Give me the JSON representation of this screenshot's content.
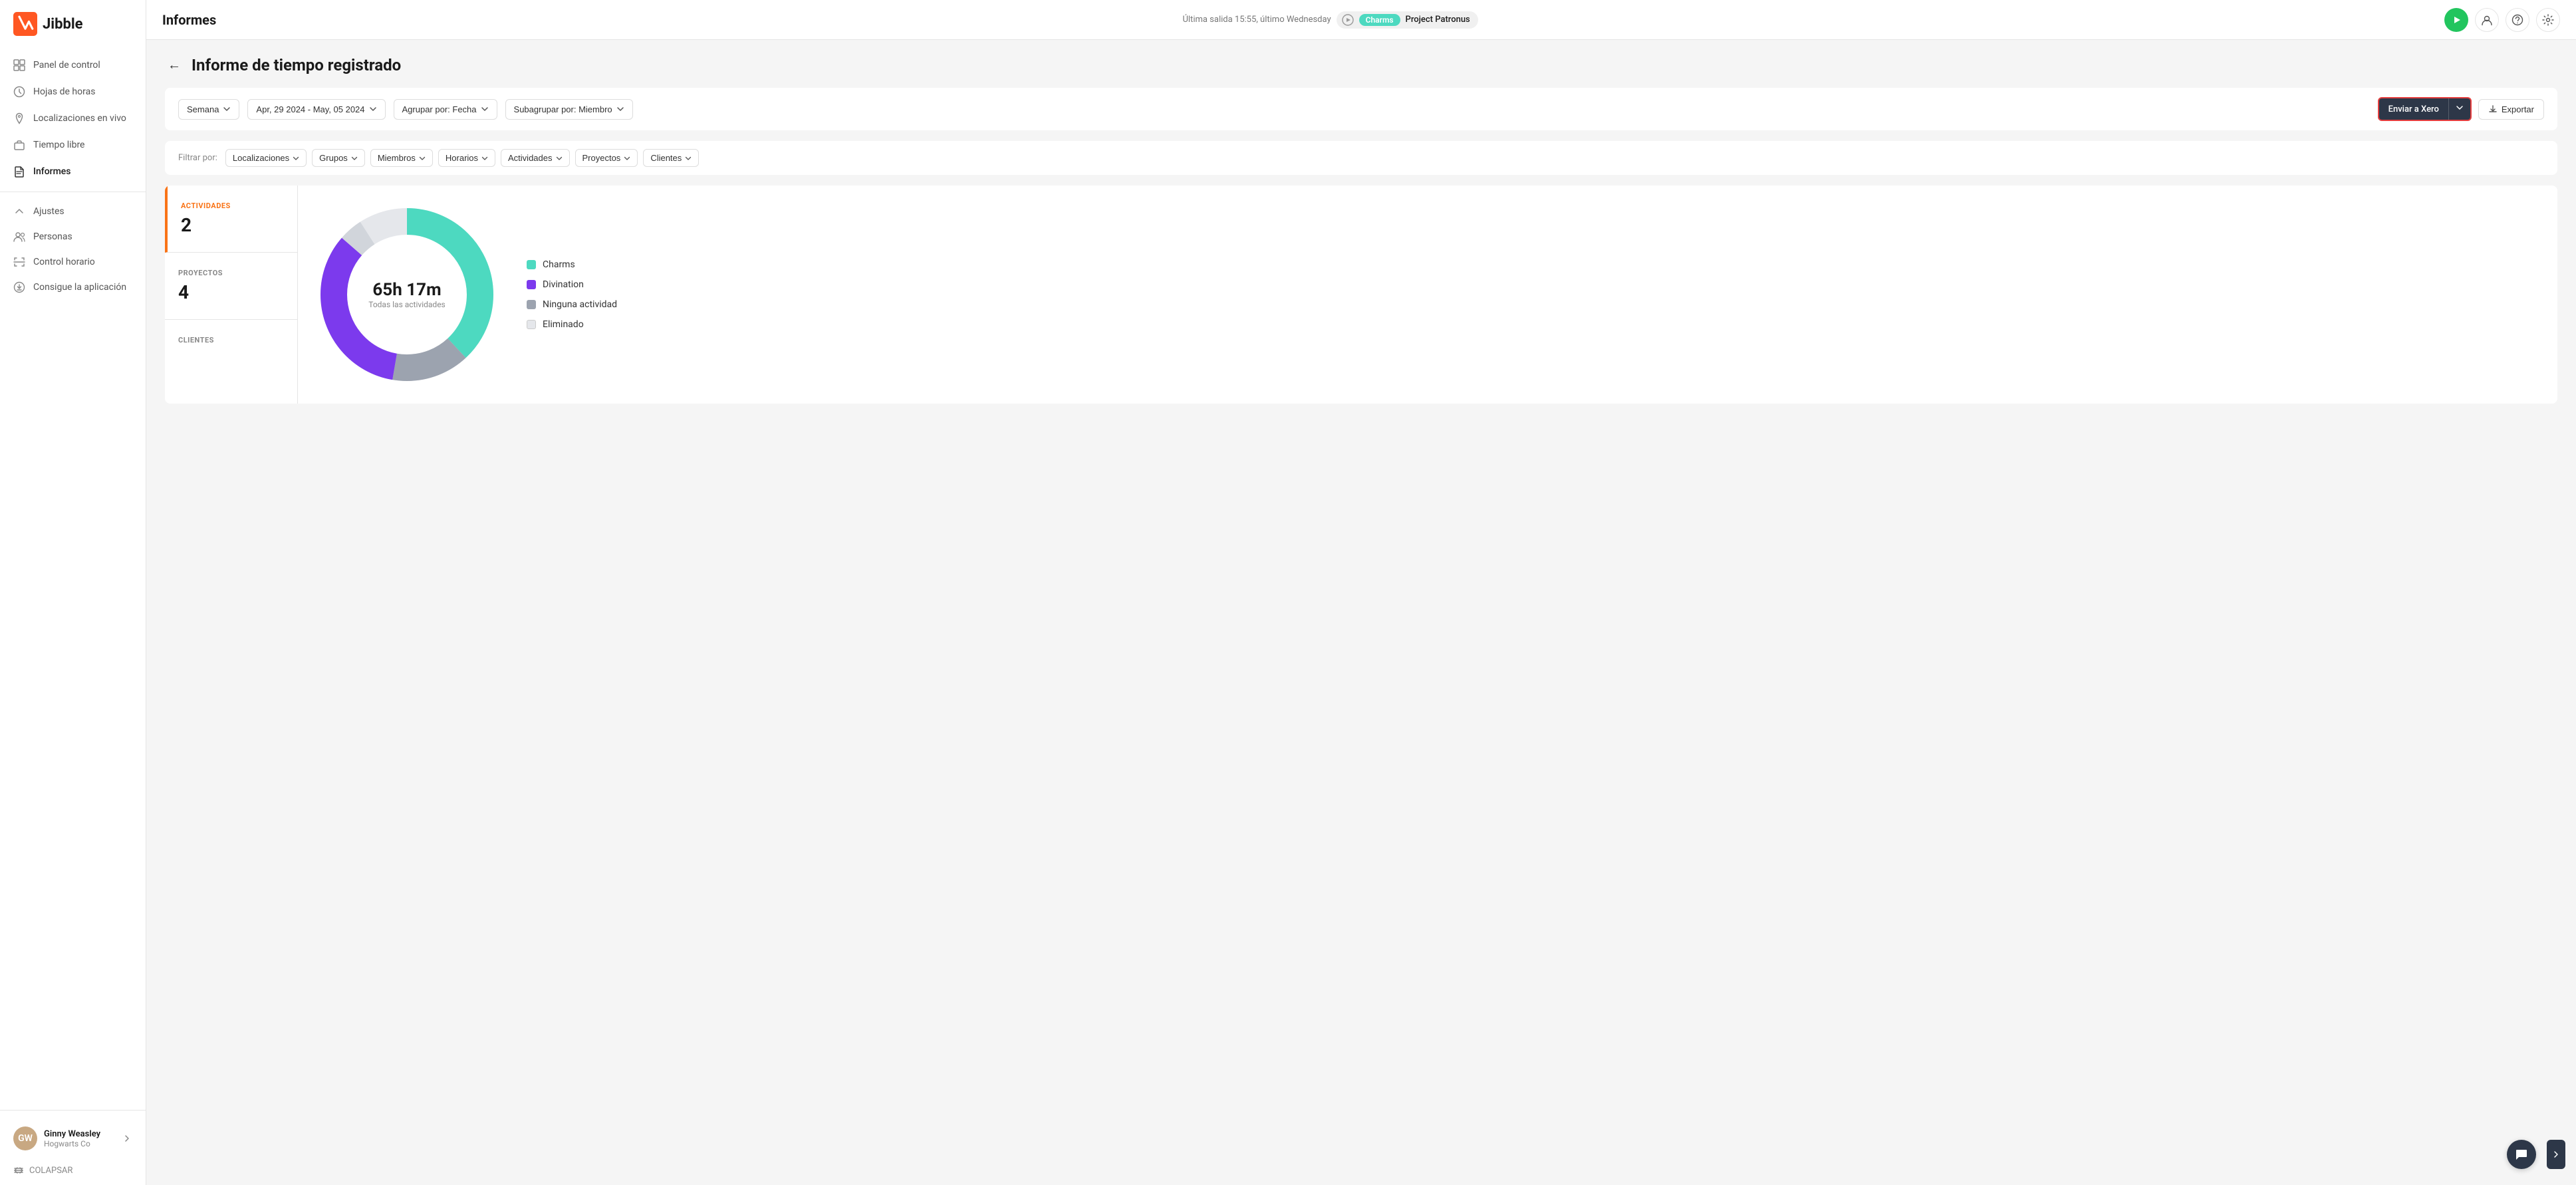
{
  "app": {
    "logo_text": "Jibble"
  },
  "header": {
    "page_title": "Informes",
    "last_exit_label": "Última salida 15:55, último Wednesday",
    "charms_tag": "Charms",
    "project_tag": "Project Patronus"
  },
  "sidebar": {
    "nav_items": [
      {
        "id": "panel",
        "label": "Panel de control",
        "icon": "grid"
      },
      {
        "id": "hojas",
        "label": "Hojas de horas",
        "icon": "clock"
      },
      {
        "id": "localizaciones",
        "label": "Localizaciones en vivo",
        "icon": "map-pin"
      },
      {
        "id": "tiempo",
        "label": "Tiempo libre",
        "icon": "briefcase"
      },
      {
        "id": "informes",
        "label": "Informes",
        "icon": "file-text",
        "active": true
      }
    ],
    "bottom_items": [
      {
        "id": "ajustes",
        "label": "Ajustes",
        "icon": "chevron-up"
      },
      {
        "id": "personas",
        "label": "Personas",
        "icon": "users"
      },
      {
        "id": "control",
        "label": "Control horario",
        "icon": "scan"
      },
      {
        "id": "app",
        "label": "Consigue la aplicación",
        "icon": "download-circle"
      }
    ],
    "user": {
      "name": "Ginny Weasley",
      "org": "Hogwarts Co",
      "initials": "GW"
    },
    "collapse_label": "COLAPSAR"
  },
  "report": {
    "back_label": "←",
    "title": "Informe de tiempo registrado",
    "filters": {
      "period": "Semana",
      "date_range": "Apr, 29 2024 - May, 05 2024",
      "group_by": "Agrupar por: Fecha",
      "subgroup_by": "Subagrupar por: Miembro"
    },
    "actions": {
      "send_xero": "Enviar a Xero",
      "export": "Exportar"
    },
    "filter_by_label": "Filtrar por:",
    "filter_chips": [
      "Localizaciones",
      "Grupos",
      "Miembros",
      "Horarios",
      "Actividades",
      "Proyectos",
      "Clientes"
    ],
    "stats": [
      {
        "label": "ACTIVIDADES",
        "value": "2",
        "accent": true
      },
      {
        "label": "PROYECTOS",
        "value": "4",
        "accent": false
      },
      {
        "label": "CLIENTES",
        "value": "",
        "accent": false
      }
    ],
    "chart": {
      "total_time": "65h 17m",
      "total_label": "Todas las actividades",
      "legend": [
        {
          "label": "Charms",
          "color": "#4dd9c0"
        },
        {
          "label": "Divination",
          "color": "#7c3aed"
        },
        {
          "label": "Ninguna actividad",
          "color": "#9ca3af"
        },
        {
          "label": "Eliminado",
          "color": "#e5e7eb"
        }
      ],
      "segments": [
        {
          "label": "Charms",
          "color": "#4dd9c0",
          "percent": 42
        },
        {
          "label": "Ninguna actividad",
          "color": "#9ca3af",
          "percent": 16
        },
        {
          "label": "Divination",
          "color": "#7c3aed",
          "percent": 37
        },
        {
          "label": "Eliminado",
          "color": "#e5e7eb",
          "percent": 5
        }
      ]
    }
  }
}
